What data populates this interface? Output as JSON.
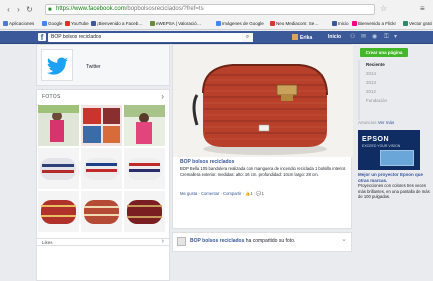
{
  "browser": {
    "url_host": "https://www.facebook.com",
    "url_path": "/bopbolsosreciclados/?fref=ts",
    "bookmarks": [
      {
        "label": "Aplicaciones",
        "color": "#4a7bd0"
      },
      {
        "label": "Google",
        "color": "#4285f4"
      },
      {
        "label": "YouTube",
        "color": "#e52d27"
      },
      {
        "label": "¡Bienvenido a Faceb…",
        "color": "#3b5998"
      },
      {
        "label": "eWEPSA | Valoració…",
        "color": "#6a8a3a"
      },
      {
        "label": "Imágenes de Google",
        "color": "#4285f4"
      },
      {
        "label": "Neo Mediacom: Se…",
        "color": "#d33"
      },
      {
        "label": "Inicio",
        "color": "#3b5998"
      },
      {
        "label": "Bienvenido a Flickr",
        "color": "#ff0084"
      },
      {
        "label": "Vector grati",
        "color": "#2a8a6a"
      }
    ]
  },
  "facebook": {
    "search_value": "BOP bolsos reciclados",
    "user_name": "Erika",
    "home_label": "Inicio"
  },
  "left": {
    "profile_name": "Twitter",
    "photos_header": "FOTOS",
    "footer_label": "Likes"
  },
  "post": {
    "title": "BOP bolsos reciclados",
    "description": "BOP Bella 105 bandolera realizada con manguera de incendio reciclada 1 bolsillo interior. Cremallera exterior. medidas: alto: 16 cm. profundidad: 10cm largo: 28 cm.",
    "actions": "Me gusta · Comentar · Compartir · 👍1 · 💬1",
    "next_author": "BOP bolsos reciclados",
    "next_text": " ha compartido su foto."
  },
  "right": {
    "create_label": "Crear una página",
    "years": [
      "Reciente",
      "2014",
      "2013",
      "2012",
      "Fundación"
    ],
    "ads_header": "Anuncios",
    "ads_more": "Ver más",
    "ad_brand": "EPSON",
    "ad_tagline": "EXCEED YOUR VISION",
    "ad_title": "Mejor un proyector Epson que otras marcas.",
    "ad_text": "Proyecciones con colores tres veces más brillantes, en una pantalla de más de 100 pulgadas."
  },
  "colors": {
    "fb_blue": "#3b5998",
    "link": "#365899",
    "green": "#42b72a"
  }
}
